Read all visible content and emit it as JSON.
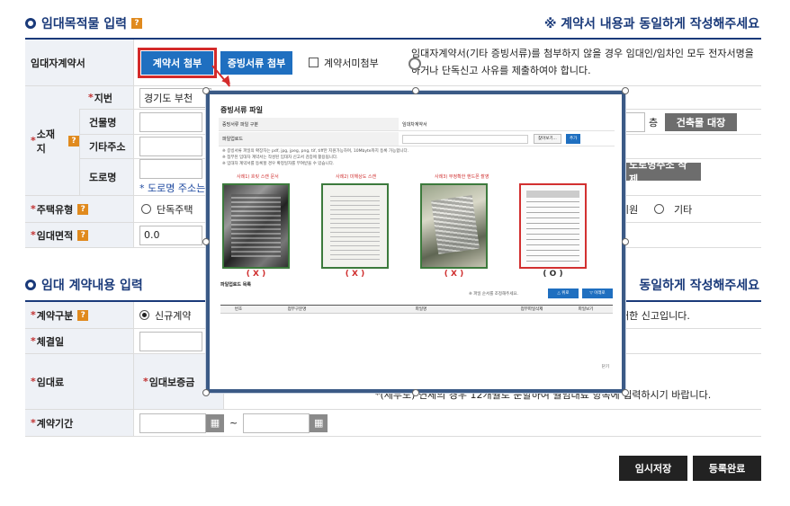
{
  "section1": {
    "title": "임대목적물 입력",
    "note": "※ 계약서 내용과 동일하게 작성해주세요",
    "contract_label": "임대자계약서",
    "btn_contract": "계약서 첨부",
    "btn_evidence": "증빙서류 첨부",
    "no_contract_label": "계약서미첨부",
    "contract_desc_1": "임대자계약서(기타 증빙서류)를 첨부하지 않을 경우 임대인/임차인 모두 전자서명을",
    "contract_desc_2": "하거나 단독신고 사유를 제출하여야 합니다.",
    "location_label": "소재지",
    "jibun_label": "지번",
    "jibun_value": "경기도 부천",
    "building_label": "건물명",
    "floor_unit": "층",
    "btn_building": "건축물 대장",
    "other_addr_label": "기타주소",
    "road_label": "도로명",
    "btn_road_delete": "도로명주소 삭제",
    "road_note": "* 도로명 주소는",
    "house_type_label": "주택유형",
    "house_type_option1": "단독주택",
    "house_type_option_mid": "시원",
    "house_type_option_last": "기타",
    "area_label": "임대면적",
    "area_value": "0.0"
  },
  "section2": {
    "title": "임대 계약내용 입력",
    "note_partial": "동일하게 작성해주세요",
    "contract_type_label": "계약구분",
    "contract_type_new": "신규계약",
    "contract_type_note": "대한 신고입니다.",
    "conclusion_label": "체결일",
    "rent_label": "임대료",
    "deposit_label": "임대보증금",
    "rent_note": "*(세무도) 연체의 경우 12개월로 분할하여 월임대료 항목에 입력하시기 바랍니다.",
    "period_label": "계약기간",
    "period_sep": "~"
  },
  "buttons": {
    "temp_save": "임시저장",
    "register": "등록완료"
  },
  "modal": {
    "title": "증빙서류 파일",
    "doc_type_label": "증빙서류 파일 구분",
    "doc_type_value": "임대차계약서",
    "upload_label": "파일업로드",
    "btn_browse": "찾아보기...",
    "btn_add": "추가",
    "hint1": "※ 증빙서류 파일의 확장자는 pdf, jpg, jpeg, png, tif, tiff만 지원가능하며, 10Mbyte까지 등록 가능합니다.",
    "hint2": "※ 첨부된 임대차 계약서는 작성된 임대차 신고서 검증에 활용됩니다.",
    "hint3": "※ 임대차 계약서를 등록할 경우 확정일자를 부여받을 수 있습니다.",
    "example_labels": [
      "사례1) 흐릿 스캔 문서",
      "사례2) 미해상도 스캔",
      "사례3) 부정확한 핸드폰 촬영",
      ""
    ],
    "marks": [
      "( X )",
      "( X )",
      "( X )",
      "( O )"
    ],
    "list_title": "파일업로드 목록",
    "order_note": "※ 파일 순서를 조정해주세요.",
    "btn_up": "△ 위로",
    "btn_down": "▽ 아래로",
    "col_no": "번호",
    "col_type": "첨부구분명",
    "col_file": "파일명",
    "col_delete": "첨부파일삭제",
    "col_view": "파일보기",
    "close": "닫기"
  },
  "colors": {
    "primary_navy": "#1a3a7a",
    "blue_button": "#1f6fc0",
    "badge_orange": "#e08a1e",
    "highlight_red": "#d42a2a"
  }
}
